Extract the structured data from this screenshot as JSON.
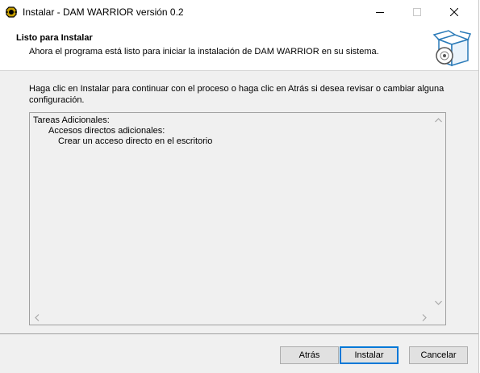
{
  "window": {
    "title": "Instalar - DAM WARRIOR versión 0.2",
    "accent_color": "#0078d7"
  },
  "header": {
    "title": "Listo para Instalar",
    "subtitle": "Ahora el programa está listo para iniciar la instalación de DAM WARRIOR en su sistema.",
    "icon": "setup-box-disc-icon"
  },
  "intro_text": "Haga clic en Instalar para continuar con el proceso o haga clic en Atrás si desea revisar o cambiar alguna configuración.",
  "memo": {
    "lines": [
      "Tareas Adicionales:",
      "Accesos directos adicionales:",
      "Crear un acceso directo en el escritorio"
    ]
  },
  "buttons": {
    "back": "Atrás",
    "install": "Instalar",
    "cancel": "Cancelar"
  }
}
